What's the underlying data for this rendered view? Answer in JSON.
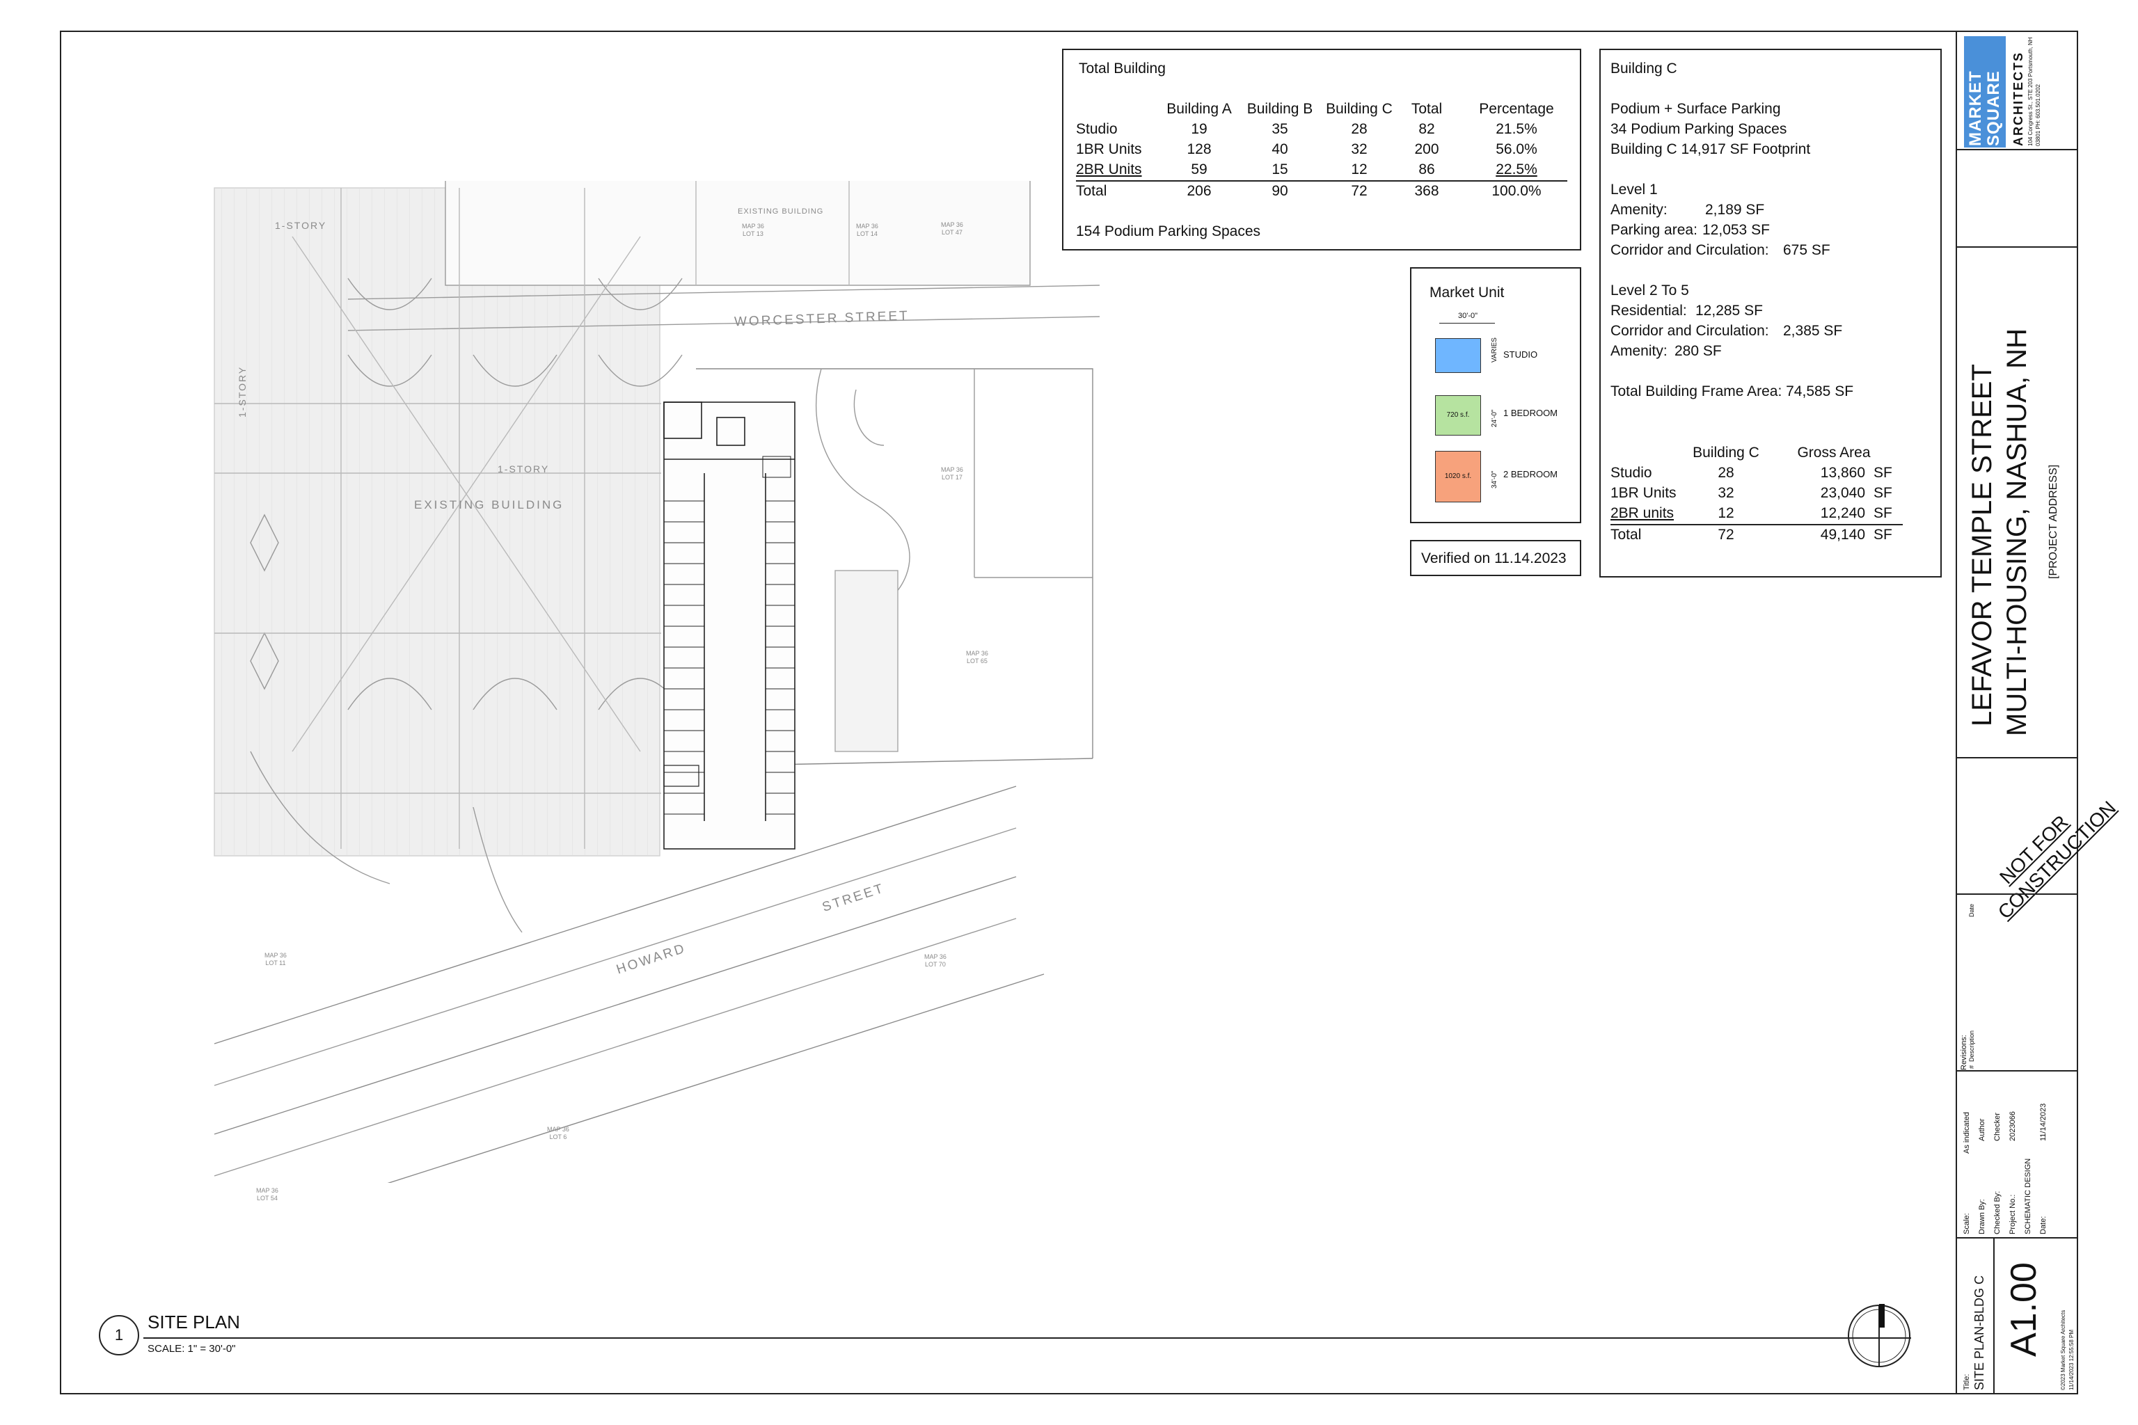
{
  "total_building": {
    "title": "Total Building",
    "headers": [
      "Building A",
      "Building B",
      "Building C",
      "Total",
      "Percentage"
    ],
    "rows": [
      {
        "label": "Studio",
        "a": "19",
        "b": "35",
        "c": "28",
        "total": "82",
        "pct": "21.5%"
      },
      {
        "label": "1BR Units",
        "a": "128",
        "b": "40",
        "c": "32",
        "total": "200",
        "pct": "56.0%"
      },
      {
        "label": "2BR Units",
        "a": "59",
        "b": "15",
        "c": "12",
        "total": "86",
        "pct": "22.5%"
      },
      {
        "label": "Total",
        "a": "206",
        "b": "90",
        "c": "72",
        "total": "368",
        "pct": "100.0%"
      }
    ],
    "parking_note": "154 Podium Parking Spaces"
  },
  "market_unit": {
    "title": "Market Unit",
    "width_dim": "30'-0\"",
    "units": [
      {
        "name": "STUDIO",
        "size": "",
        "dim": "VARIES",
        "color": "#6fb6ff"
      },
      {
        "name": "1 BEDROOM",
        "size": "720 s.f.",
        "dim": "24'-0\"",
        "color": "#b6e3a0"
      },
      {
        "name": "2 BEDROOM",
        "size": "1020 s.f.",
        "dim": "34'-0\"",
        "color": "#f7a27c"
      }
    ]
  },
  "verified": "Verified on 11.14.2023",
  "building_c": {
    "title": "Building C",
    "lines": [
      "Podium + Surface Parking",
      "34 Podium Parking Spaces",
      "Building C 14,917 SF Footprint"
    ],
    "level1_title": "Level 1",
    "level1": [
      {
        "label": "Amenity:",
        "value": "2,189 SF"
      },
      {
        "label": "Parking area:",
        "value": "12,053 SF"
      },
      {
        "label": "Corridor and Circulation:",
        "value": "675 SF"
      }
    ],
    "level2_title": "Level 2 To 5",
    "level2": [
      {
        "label": "Residential:",
        "value": "12,285 SF"
      },
      {
        "label": "Corridor and Circulation:",
        "value": "2,385 SF"
      },
      {
        "label": "Amenity:",
        "value": "280 SF"
      }
    ],
    "frame_area": "Total Building Frame Area: 74,585 SF",
    "table_headers": [
      "Building C",
      "Gross Area"
    ],
    "table_rows": [
      {
        "label": "Studio",
        "count": "28",
        "area": "13,860",
        "unit": "SF"
      },
      {
        "label": "1BR Units",
        "count": "32",
        "area": "23,040",
        "unit": "SF"
      },
      {
        "label": "2BR units",
        "count": "12",
        "area": "12,240",
        "unit": "SF"
      },
      {
        "label": "Total",
        "count": "72",
        "area": "49,140",
        "unit": "SF"
      }
    ]
  },
  "title_block": {
    "logo_lines": [
      "MAR",
      "KET",
      "SQUA",
      "RE"
    ],
    "firm": "ARCHITECTS",
    "firm_address": "104 Congress St., STE 203  Portsmouth, NH 03801  PH: 603.501.0202",
    "project_line1": "LEFAVOR TEMPLE STREET",
    "project_line2": "MULTI-HOUSING, NASHUA, NH",
    "project_address": "[PROJECT ADDRESS]",
    "stamp": "NOT FOR CONSTRUCTION",
    "revisions_label": "Revisions:",
    "revisions_hash": "#",
    "revisions_desc": "Description",
    "revisions_date": "Date",
    "fields": [
      {
        "label": "Scale:",
        "value": "As indicated"
      },
      {
        "label": "Drawn By:",
        "value": "Author"
      },
      {
        "label": "Checked By:",
        "value": "Checker"
      },
      {
        "label": "Project No.:",
        "value": "2023066"
      }
    ],
    "phase": "SCHEMATIC DESIGN",
    "date_label": "Date:",
    "date_value": "11/14/2023",
    "sheet_title_label": "Title:",
    "sheet_title": "SITE PLAN-BLDG C",
    "sheet_number": "A1.00",
    "copyright": "©2023 Market Square Architects",
    "print_stamp": "11/14/2023 12:55:58 PM"
  },
  "drawing": {
    "number": "1",
    "title": "SITE PLAN",
    "scale": "SCALE:  1\" = 30'-0\""
  },
  "site_labels": {
    "worcester": "WORCESTER STREET",
    "howard": "HOWARD",
    "street": "STREET",
    "existing_building": "EXISTING BUILDING",
    "existing_building_top": "EXISTING BUILDING",
    "one_story": "1-STORY",
    "one_story_2": "1-STORY",
    "one_story_3": "1-STORY",
    "map_labels": [
      "MAP 36\nLOT 13",
      "MAP 36\nLOT 14",
      "MAP 36\nLOT 47",
      "MAP 36\nLOT 17",
      "MAP 36\nLOT 65",
      "MAP 36\nLOT 11",
      "MAP 36\nLOT 70",
      "MAP 36\nLOT 6",
      "MAP 36\nLOT 54"
    ]
  }
}
